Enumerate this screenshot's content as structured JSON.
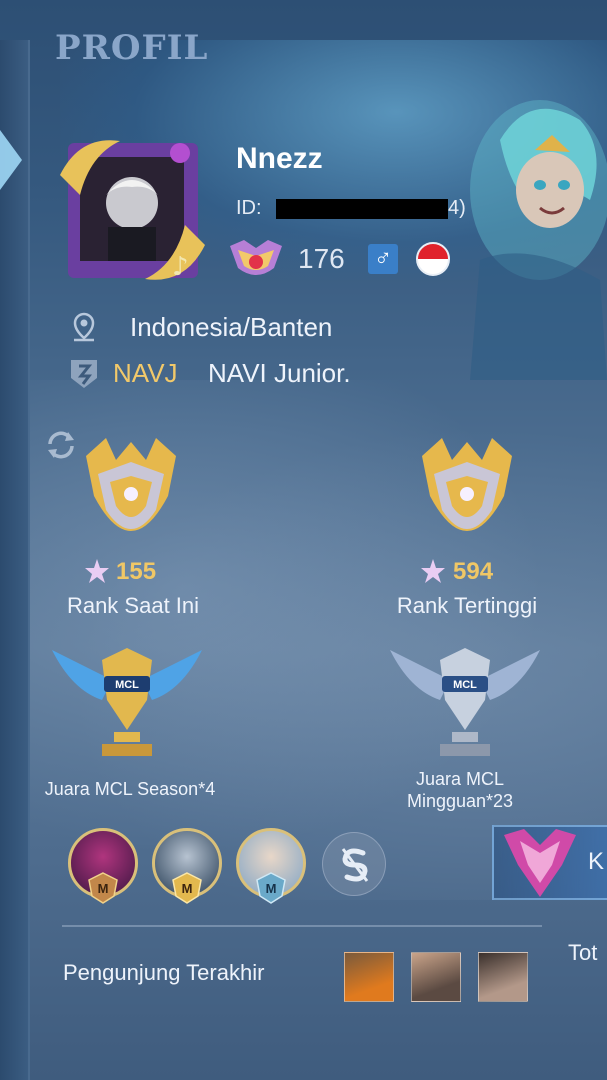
{
  "header": {
    "title": "PROFIL"
  },
  "profile": {
    "name": "Nnezz",
    "id_label": "ID:",
    "id_tail": "4)",
    "level": "176",
    "gender_symbol": "♂",
    "location": "Indonesia/Banten",
    "squad_tag": "NAVJ",
    "squad_name": "NAVI Junior."
  },
  "ranks": [
    {
      "stars": "155",
      "label": "Rank Saat Ini"
    },
    {
      "stars": "594",
      "label": "Rank Tertinggi"
    }
  ],
  "achievements": [
    {
      "label_line1": "Juara MCL Season*4",
      "label_line2": ""
    },
    {
      "label_line1": "Juara MCL",
      "label_line2": "Mingguan*23"
    }
  ],
  "heroes": {
    "badge_letter": "M",
    "colors": [
      "#6b2a7a",
      "#3b5f7e",
      "#8fb3cf"
    ]
  },
  "side_panel": {
    "text": "K",
    "tot": "Tot"
  },
  "visitors": {
    "label": "Pengunjung Terakhir",
    "count": 3
  },
  "colors": {
    "accent_gold": "#f0c766",
    "squad_gold": "#f2c96a",
    "gender_blue": "#3a7fc8",
    "flag_red": "#e0222c"
  }
}
